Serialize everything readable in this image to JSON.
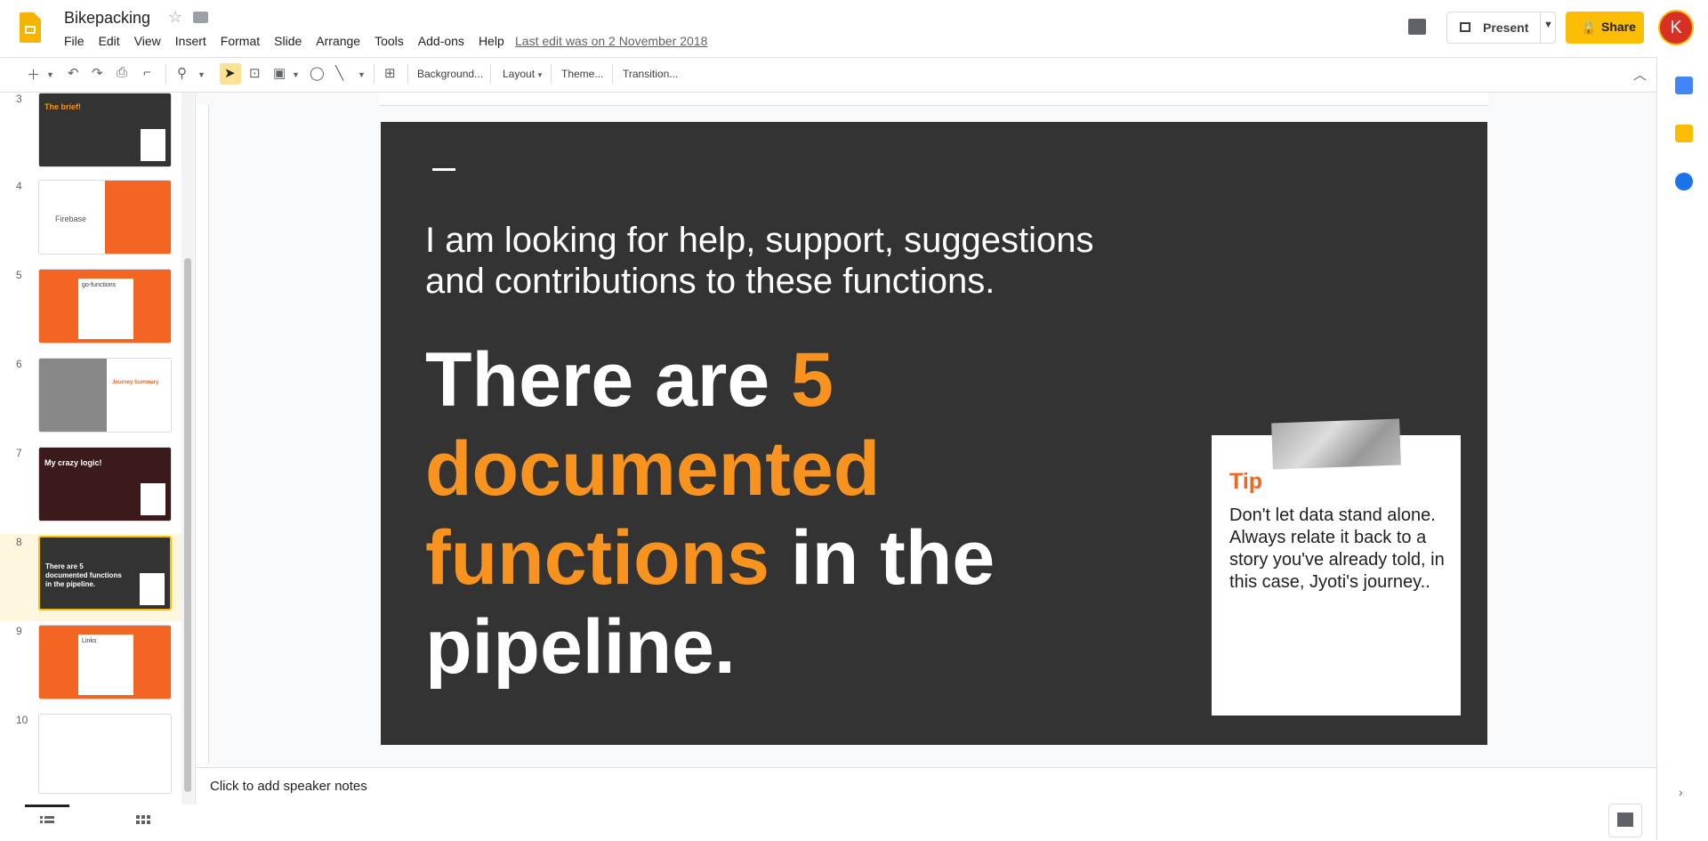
{
  "header": {
    "doc_title": "Bikepacking",
    "menu": [
      "File",
      "Edit",
      "View",
      "Insert",
      "Format",
      "Slide",
      "Arrange",
      "Tools",
      "Add-ons",
      "Help"
    ],
    "last_edit": "Last edit was on 2 November 2018",
    "present_label": "Present",
    "share_label": "Share",
    "avatar_initial": "K"
  },
  "toolbar": {
    "background_label": "Background...",
    "layout_label": "Layout",
    "theme_label": "Theme...",
    "transition_label": "Transition..."
  },
  "filmstrip": {
    "slides": [
      {
        "num": "3",
        "title": "The brief!"
      },
      {
        "num": "4",
        "title": "Firebase"
      },
      {
        "num": "5",
        "title": "go-functions"
      },
      {
        "num": "6",
        "title": "Journey Summary"
      },
      {
        "num": "7",
        "title": "My crazy logic!"
      },
      {
        "num": "8",
        "title": "There are 5 documented functions in the pipeline."
      },
      {
        "num": "9",
        "title": "Links"
      },
      {
        "num": "10",
        "title": ""
      }
    ]
  },
  "slide": {
    "subtitle": "I am looking for help, support, suggestions and contributions to these functions.",
    "main_a": "There are ",
    "main_b": "5 documented functions",
    "main_c": " in the pipeline.",
    "tip_title": "Tip",
    "tip_body": "Don't let data stand alone. Always relate it back to a story you've already told, in this case, Jyoti's journey.."
  },
  "notes": {
    "placeholder": "Click to add speaker notes"
  },
  "colors": {
    "accent": "#fbbc04",
    "slide_bg": "#333333",
    "highlight": "#f7931e",
    "tip_title": "#f26522"
  }
}
